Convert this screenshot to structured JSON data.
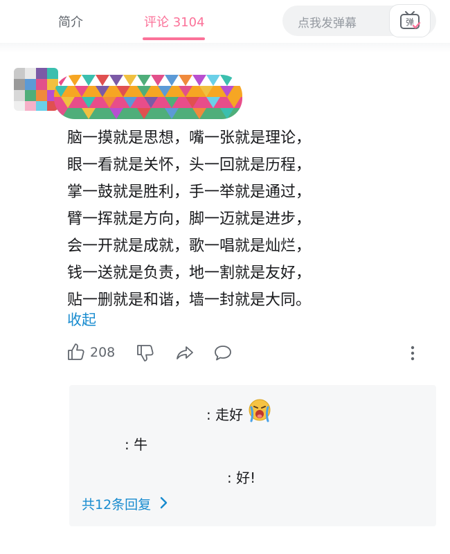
{
  "tabs": {
    "intro_label": "简介",
    "comments_label": "评论 3104"
  },
  "danmaku": {
    "placeholder": "点我发弹幕",
    "button_label": "弹"
  },
  "comment": {
    "lines": [
      "脑一摸就是思想，嘴一张就是理论，",
      "眼一看就是关怀，头一回就是历程，",
      "掌一鼓就是胜利，手一举就是通过，",
      "臂一挥就是方向，脚一迈就是进步，",
      "会一开就是成就，歌一唱就是灿烂，",
      "钱一送就是负责，地一割就是友好，",
      "贴一删就是和谐，墙一封就是大同。"
    ],
    "collapse_label": "收起",
    "like_count": "208"
  },
  "replies": {
    "items": [
      ": 走好",
      ": 牛",
      ": 好!"
    ],
    "view_all_label": "共12条回复"
  },
  "colors": {
    "accent_pink": "#fb7299",
    "link_blue": "#178bcf"
  }
}
